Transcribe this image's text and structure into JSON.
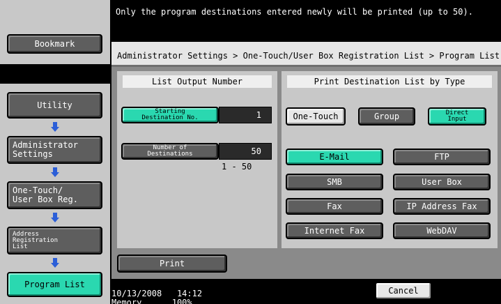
{
  "message": "Only the program destinations entered newly will be printed (up to 50).",
  "sidebar": {
    "bookmark": "Bookmark",
    "utility": "Utility",
    "admin": [
      "Administrator",
      "Settings"
    ],
    "onetouch": [
      "One-Touch/",
      "User Box Reg."
    ],
    "address": [
      "Address",
      "Registration",
      "List"
    ],
    "program": "Program List"
  },
  "breadcrumb": "Administrator Settings > One-Touch/User Box Registration List > Program List",
  "list_output": {
    "heading": "List Output Number",
    "starting_label": [
      "Starting",
      "Destination No."
    ],
    "starting_value": "1",
    "number_label": [
      "Number of",
      "Destinations"
    ],
    "number_value": "50",
    "range": "1  -  50"
  },
  "print_by_type": {
    "heading": "Print Destination List by Type",
    "one_touch": "One-Touch",
    "group": "Group",
    "direct_input": [
      "Direct",
      "Input"
    ],
    "email": "E-Mail",
    "ftp": "FTP",
    "smb": "SMB",
    "user_box": "User Box",
    "fax": "Fax",
    "ip_fax": "IP Address Fax",
    "internet_fax": "Internet Fax",
    "webdav": "WebDAV"
  },
  "print_button": "Print",
  "cancel_button": "Cancel",
  "status": {
    "date": "10/13/2008",
    "time": "14:12",
    "memory_label": "Memory",
    "memory_value": "100%"
  },
  "colors": {
    "accent": "#2ad8b0",
    "arrow": "#2b5ed8",
    "button": "#5e5e5e"
  }
}
